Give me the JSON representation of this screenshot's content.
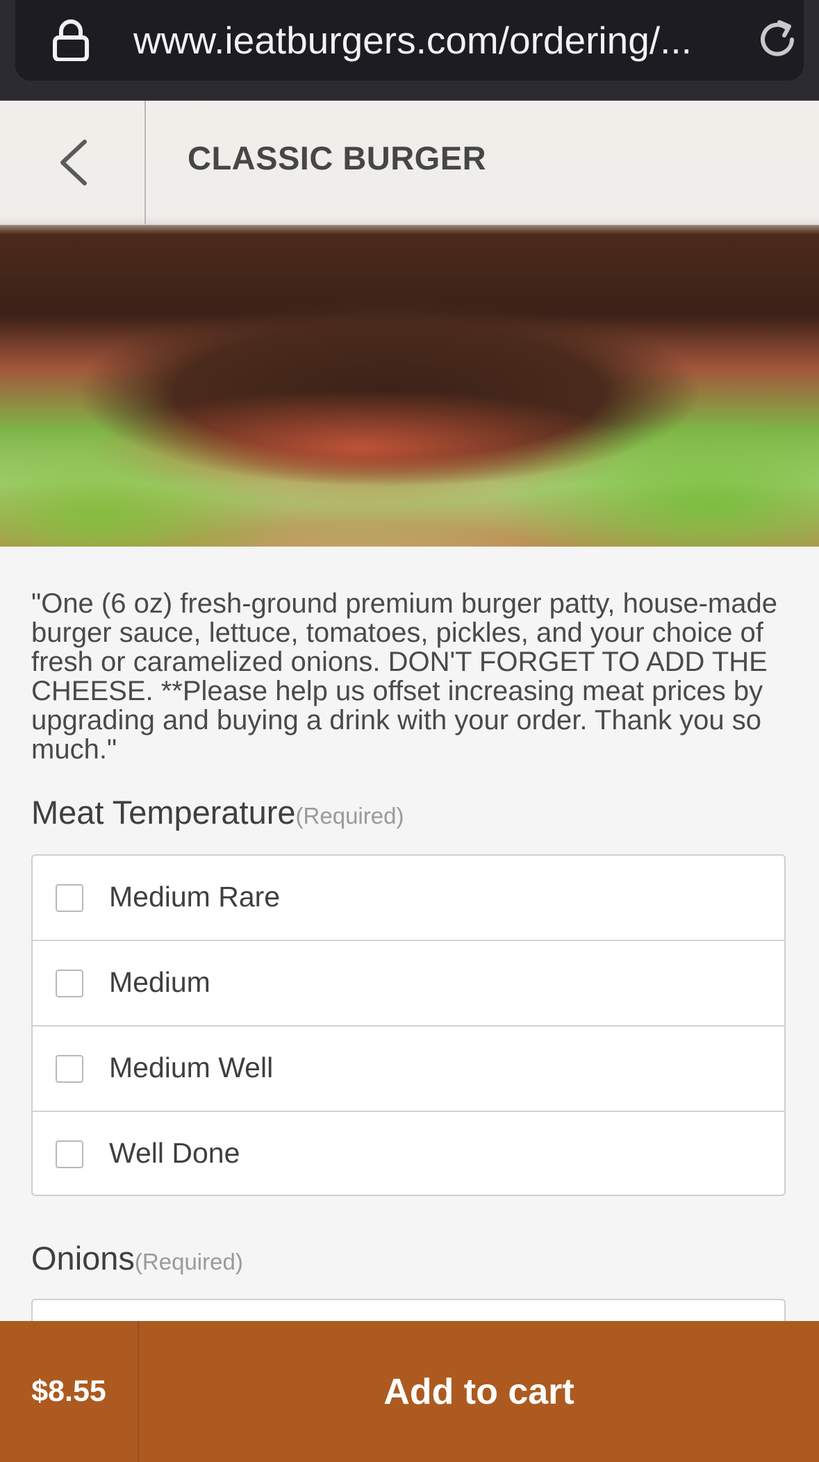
{
  "browser": {
    "url": "www.ieatburgers.com/ordering/..."
  },
  "header": {
    "title": "CLASSIC BURGER"
  },
  "item": {
    "description": "\"One (6 oz) fresh-ground premium burger patty, house-made burger sauce, lettuce, tomatoes, pickles, and your choice of fresh or caramelized onions. DON'T FORGET TO ADD THE CHEESE. **Please help us offset increasing meat prices by upgrading and buying a drink with your order. Thank you so much.\""
  },
  "sections": [
    {
      "name": "Meat Temperature",
      "required": "(Required)",
      "options": [
        {
          "label": "Medium Rare",
          "checked": false
        },
        {
          "label": "Medium",
          "checked": false
        },
        {
          "label": "Medium Well",
          "checked": false
        },
        {
          "label": "Well Done",
          "checked": false
        }
      ]
    },
    {
      "name": "Onions",
      "required": "(Required)"
    }
  ],
  "footer": {
    "price": "$8.55",
    "add_to_cart": "Add to cart"
  },
  "colors": {
    "accent": "#ad5a20",
    "browser_bar": "#1c1c22",
    "background": "#f5f5f5"
  },
  "icons": {
    "lock": "lock-icon",
    "reload": "reload-icon",
    "back": "chevron-left-icon"
  }
}
